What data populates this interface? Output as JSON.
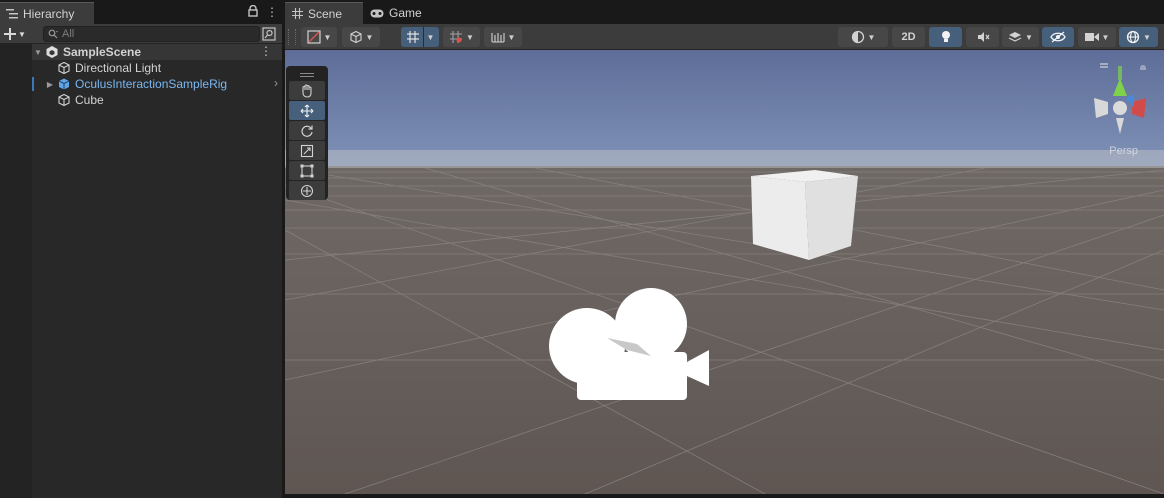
{
  "hierarchy": {
    "tab_title": "Hierarchy",
    "search_placeholder": "All",
    "scene_name": "SampleScene",
    "items": [
      {
        "label": "Directional Light",
        "type": "gameobject"
      },
      {
        "label": "OculusInteractionSampleRig",
        "type": "prefab"
      },
      {
        "label": "Cube",
        "type": "gameobject"
      }
    ]
  },
  "scene_view": {
    "tabs": [
      {
        "label": "Scene",
        "icon": "grid-icon",
        "active": true
      },
      {
        "label": "Game",
        "icon": "gamepad-icon",
        "active": false
      }
    ],
    "toolbar": {
      "mode_2d_label": "2D",
      "lighting_on": true,
      "gizmos_on": true
    },
    "tools": [
      "hand-tool",
      "move-tool",
      "rotate-tool",
      "scale-tool",
      "rect-tool",
      "transform-tool"
    ],
    "active_tool": "move-tool",
    "projection_label": "Persp"
  },
  "colors": {
    "accent": "#46607c",
    "prefab_text": "#7ab7f0",
    "panel_bg": "#282828",
    "toolbar_bg": "#3c3c3c"
  }
}
